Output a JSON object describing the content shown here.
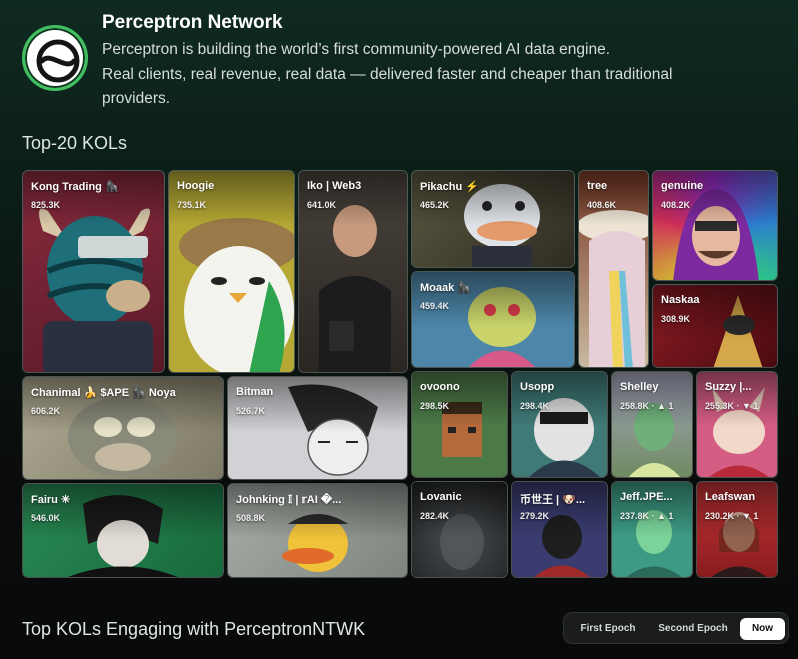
{
  "project": {
    "name": "Perceptron Network",
    "description_lines": [
      "Perceptron is building the world’s first community-powered AI data engine.",
      "Real clients, real revenue, real data — delivered faster and cheaper than traditional",
      "providers."
    ]
  },
  "kols_section": {
    "title": "Top-20 KOLs",
    "tiles": [
      {
        "name": "Kong Trading 🦍",
        "value": "825.3K",
        "color": "#7a2636"
      },
      {
        "name": "Hoogie",
        "value": "735.1K",
        "color": "#b5a834"
      },
      {
        "name": "Iko | Web3",
        "value": "641.0K",
        "color": "#3a3530"
      },
      {
        "name": "Pikachu ⚡",
        "value": "465.2K",
        "color": "#4a4636"
      },
      {
        "name": "tree",
        "value": "408.6K",
        "color": "#7a3a25"
      },
      {
        "name": "genuine",
        "value": "408.2K",
        "color": "#7b2d9a"
      },
      {
        "name": "Moaak 🦍",
        "value": "459.4K",
        "color": "#4d86a8"
      },
      {
        "name": "Naskaa",
        "value": "308.9K",
        "color": "#8e1c24"
      },
      {
        "name": "Chanimal 🍌 $APE 🦍 Noya",
        "value": "606.2K",
        "color": "#9a9680"
      },
      {
        "name": "Bitman",
        "value": "526.7K",
        "color": "#c9c9cc"
      },
      {
        "name": "ovoono",
        "value": "298.5K",
        "color": "#4c7a47"
      },
      {
        "name": "Usopp",
        "value": "298.4K",
        "color": "#3f7a77"
      },
      {
        "name": "Shelley",
        "value": "258.8K · ▲ 1",
        "color": "#6f8a60"
      },
      {
        "name": "Suzzy |...",
        "value": "255.3K · ▼ 1",
        "color": "#d45d84"
      },
      {
        "name": "Fairu ✳",
        "value": "546.0K",
        "color": "#237a4b"
      },
      {
        "name": "Johnking 𝕀 | 𝕣AI �...",
        "value": "508.8K",
        "color": "#9aa09a"
      },
      {
        "name": "Lovanic",
        "value": "282.4K",
        "color": "#2a2d2f"
      },
      {
        "name": "币世王 | 🐶...",
        "value": "279.2K",
        "color": "#3a3c70"
      },
      {
        "name": "Jeff.JPE...",
        "value": "237.8K · ▲ 1",
        "color": "#3d9a83"
      },
      {
        "name": "Leafswan",
        "value": "230.2K · ▼ 1",
        "color": "#b3282a"
      }
    ]
  },
  "engaging_section": {
    "title": "Top KOLs Engaging with PerceptronNTWK",
    "epochs": [
      "First Epoch",
      "Second Epoch",
      "Now"
    ],
    "active_epoch": "Now"
  }
}
